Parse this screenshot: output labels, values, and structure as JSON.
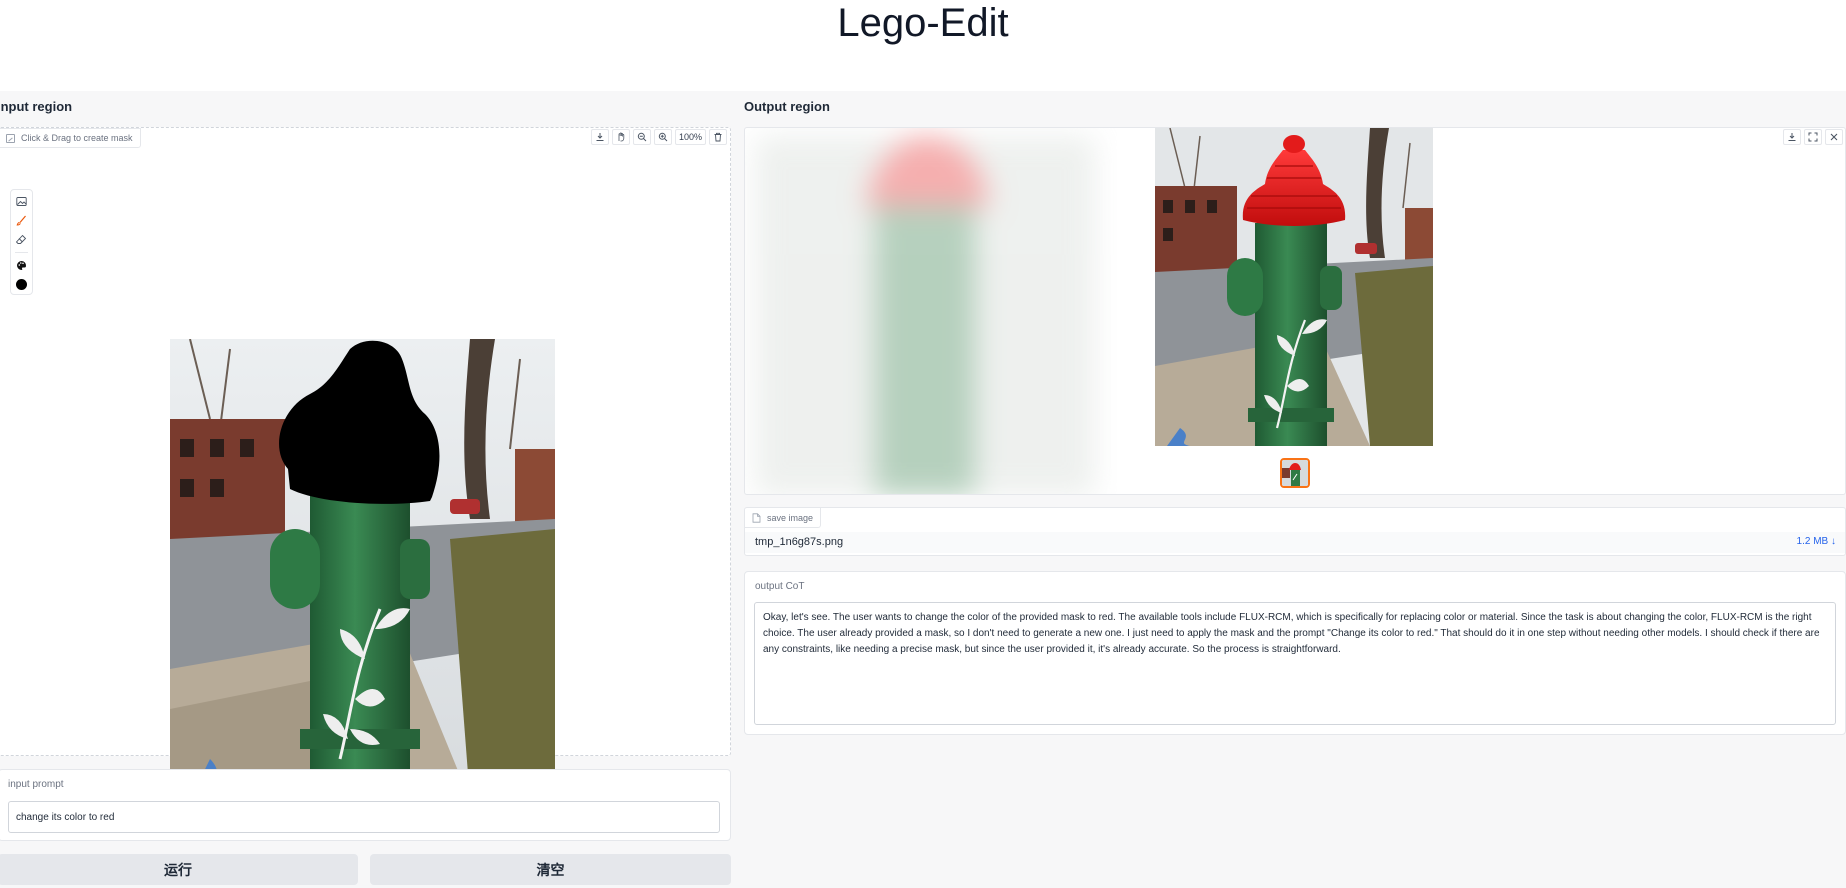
{
  "app": {
    "title": "Lego-Edit"
  },
  "input_region": {
    "title": "Input region",
    "mask_hint": "Click & Drag to create mask",
    "zoom": "100%",
    "toolbar_icons": [
      "download-icon",
      "pan-icon",
      "zoom-out-icon",
      "zoom-in-icon",
      "trash-icon"
    ],
    "tools": [
      "image-icon",
      "brush-icon",
      "eraser-icon",
      "palette-icon",
      "color-dot-icon"
    ],
    "brush_color": "#000000"
  },
  "prompt": {
    "label": "input prompt",
    "value": "change its color to red"
  },
  "buttons": {
    "run": "运行",
    "clear": "清空"
  },
  "output_region": {
    "title": "Output region",
    "actions": [
      "download-icon",
      "fullscreen-icon",
      "close-icon"
    ],
    "file": {
      "tag": "save image",
      "name": "tmp_1n6g87s.png",
      "size": "1.2 MB ↓"
    },
    "cot": {
      "label": "output CoT",
      "text": "Okay, let's see. The user wants to change the color of the provided mask to red. The available tools include FLUX-RCM, which is specifically for replacing color or material. Since the task is about changing the color, FLUX-RCM is the right choice. The user already provided a mask, so I don't need to generate a new one. I just need to apply the mask and the prompt \"Change its color to red.\" That should do it in one step without needing other models. I should check if there are any constraints, like needing a precise mask, but since the user provided it, it's already accurate. So the process is straightforward."
    }
  },
  "colors": {
    "accent": "#f97316",
    "hydrant_green": "#2f7a45",
    "cap_red": "#e31b1b",
    "link_blue": "#2563eb"
  }
}
